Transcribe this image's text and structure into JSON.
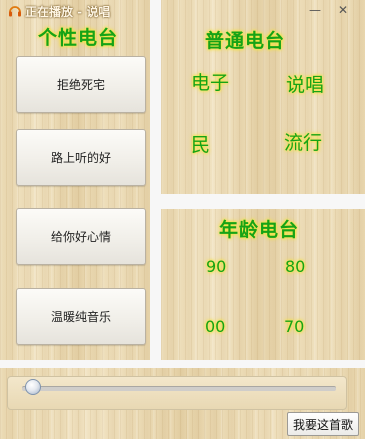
{
  "window": {
    "title": "正在播放 - 说唱",
    "minimize_glyph": "—",
    "close_glyph": "✕"
  },
  "personal": {
    "title": "个性电台",
    "buttons": [
      "拒绝死宅",
      "路上听的好",
      "给你好心情",
      "温暖纯音乐"
    ]
  },
  "normal": {
    "title": "普通电台",
    "genres": [
      "电子",
      "说唱",
      "民",
      "流行"
    ]
  },
  "age": {
    "title": "年龄电台",
    "items": [
      "90",
      "80",
      "00",
      "70"
    ]
  },
  "player": {
    "progress": 0.02,
    "want_button": "我要这首歌"
  },
  "colors": {
    "glow_text": "#16a316",
    "glow_halo": "#f6e64a",
    "wood": "#ead9b2"
  },
  "icons": {
    "title": "headphones-icon"
  }
}
